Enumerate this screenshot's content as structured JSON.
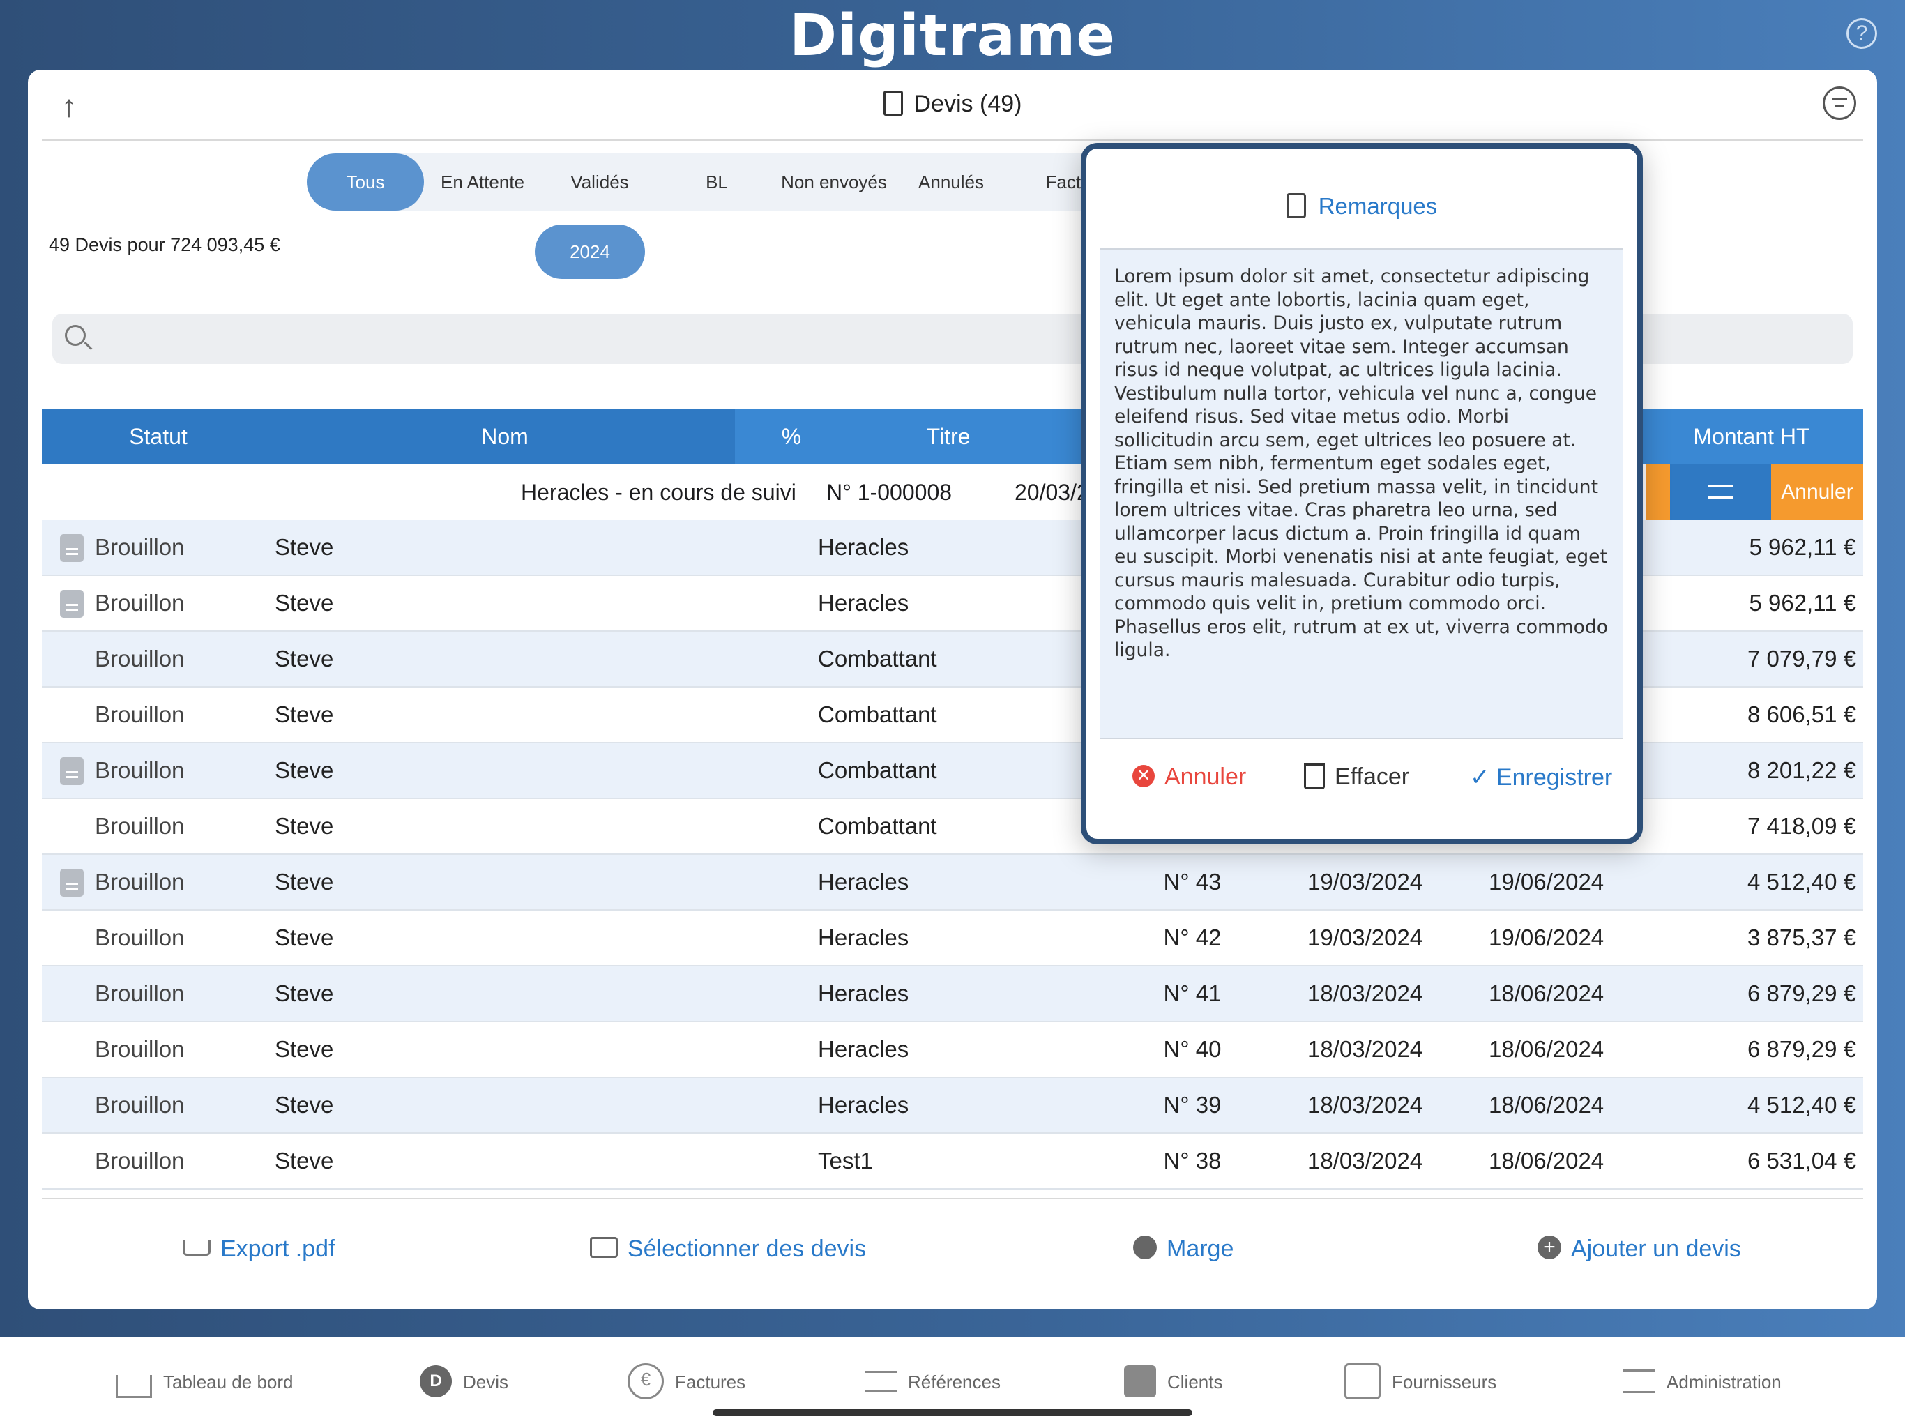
{
  "app": {
    "brand": "Digitrame",
    "help": "?"
  },
  "header": {
    "title": "Devis (49)"
  },
  "segments": [
    "Tous",
    "En Attente",
    "Validés",
    "BL",
    "Non envoyés",
    "Annulés",
    "Factu"
  ],
  "year": "2024",
  "summary": "49 Devis pour 724 093,45 €",
  "columns": {
    "statut": "Statut",
    "nom": "Nom",
    "pct": "%",
    "titre": "Titre",
    "montant": "Montant HT"
  },
  "subrow": {
    "titre": "Heracles - en cours de suivi",
    "num": "N° 1-000008",
    "date": "20/03/20",
    "cancel": "Annuler"
  },
  "rows": [
    {
      "statut": "Brouillon",
      "nom": "Steve",
      "titre": "Heracles",
      "num": "",
      "d1": "",
      "d2": "",
      "amt": "5 962,11 €"
    },
    {
      "statut": "Brouillon",
      "nom": "Steve",
      "titre": "Heracles",
      "num": "",
      "d1": "",
      "d2": "",
      "amt": "5 962,11 €"
    },
    {
      "statut": "Brouillon",
      "nom": "Steve",
      "titre": "Combattant",
      "num": "",
      "d1": "",
      "d2": "",
      "amt": "7 079,79 €"
    },
    {
      "statut": "Brouillon",
      "nom": "Steve",
      "titre": "Combattant",
      "num": "",
      "d1": "",
      "d2": "",
      "amt": "8 606,51 €"
    },
    {
      "statut": "Brouillon",
      "nom": "Steve",
      "titre": "Combattant",
      "num": "",
      "d1": "",
      "d2": "",
      "amt": "8 201,22 €"
    },
    {
      "statut": "Brouillon",
      "nom": "Steve",
      "titre": "Combattant",
      "num": "",
      "d1": "",
      "d2": "",
      "amt": "7 418,09 €"
    },
    {
      "statut": "Brouillon",
      "nom": "Steve",
      "titre": "Heracles",
      "num": "N° 43",
      "d1": "19/03/2024",
      "d2": "19/06/2024",
      "amt": "4 512,40 €"
    },
    {
      "statut": "Brouillon",
      "nom": "Steve",
      "titre": "Heracles",
      "num": "N° 42",
      "d1": "19/03/2024",
      "d2": "19/06/2024",
      "amt": "3 875,37 €"
    },
    {
      "statut": "Brouillon",
      "nom": "Steve",
      "titre": "Heracles",
      "num": "N° 41",
      "d1": "18/03/2024",
      "d2": "18/06/2024",
      "amt": "6 879,29 €"
    },
    {
      "statut": "Brouillon",
      "nom": "Steve",
      "titre": "Heracles",
      "num": "N° 40",
      "d1": "18/03/2024",
      "d2": "18/06/2024",
      "amt": "6 879,29 €"
    },
    {
      "statut": "Brouillon",
      "nom": "Steve",
      "titre": "Heracles",
      "num": "N° 39",
      "d1": "18/03/2024",
      "d2": "18/06/2024",
      "amt": "4 512,40 €"
    },
    {
      "statut": "Brouillon",
      "nom": "Steve",
      "titre": "Test1",
      "num": "N° 38",
      "d1": "18/03/2024",
      "d2": "18/06/2024",
      "amt": "6 531,04 €"
    }
  ],
  "footer": {
    "export": "Export  .pdf",
    "select": "Sélectionner des devis",
    "marge": "Marge",
    "add": "Ajouter un devis"
  },
  "tabs": [
    "Tableau de bord",
    "Devis",
    "Factures",
    "Références",
    "Clients",
    "Fournisseurs",
    "Administration"
  ],
  "tab_glyphs": {
    "devis": "D",
    "factures": "€"
  },
  "modal": {
    "title": "Remarques",
    "text": "Lorem ipsum dolor sit amet, consectetur adipiscing elit. Ut eget ante lobortis, lacinia quam eget, vehicula mauris. Duis justo ex, vulputate rutrum rutrum nec, laoreet vitae sem. Integer accumsan risus id neque volutpat, ac ultrices ligula lacinia. Vestibulum nulla tortor, vehicula vel nunc a, congue eleifend risus. Sed vitae metus odio. Morbi sollicitudin arcu sem, eget ultrices leo posuere at. Etiam sem nibh, fermentum eget sodales eget, fringilla et nisi. Sed pretium massa velit, in tincidunt lorem ultrices vitae. Cras pharetra leo urna, sed ullamcorper lacus dictum a. Proin fringilla id quam eu suscipit. Morbi venenatis nisi at ante feugiat, eget cursus mauris malesuada. Curabitur odio turpis, commodo quis velit in, pretium commodo orci. Phasellus eros elit, rutrum at ex ut, viverra commodo ligula.",
    "cancel": "Annuler",
    "clear": "Effacer",
    "save": "✓ Enregistrer"
  },
  "colors": {
    "accent": "#2979c9",
    "header_bg": "#3a88d3",
    "danger": "#e8463d",
    "swipe": "#f59a2e"
  }
}
